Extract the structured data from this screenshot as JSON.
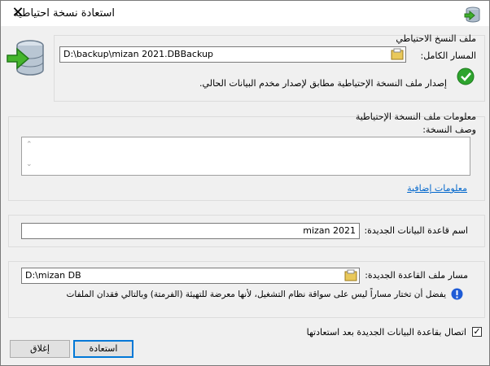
{
  "window": {
    "title": "استعادة نسخة احتياطية",
    "close_glyph": "✕"
  },
  "backup_file": {
    "group_label": "ملف النسخ الاحتياطي",
    "path_label": "المسار الكامل:",
    "path_value": "D:\\backup\\mizan 2021.DBBackup",
    "status_text": "إصدار ملف النسخة الإحتياطية مطابق لإصدار مخدم البيانات الحالي."
  },
  "backup_info": {
    "group_label": "معلومات ملف النسخة الإحتياطية",
    "description_label": "وصف النسخة:",
    "description_value": "",
    "more_info_link": "معلومات إضافية"
  },
  "new_db": {
    "name_label": "اسم قاعدة البيانات الجديدة:",
    "name_value": "mizan 2021"
  },
  "new_path": {
    "label": "مسار ملف القاعدة الجديدة:",
    "value": "D:\\mizan DB",
    "warning": "يفضل أن تختار مساراً ليس على سواقة نظام التشغيل، لأنها معرضة للتهيئة (الفرمتة) وبالتالي فقدان الملفات"
  },
  "connect_option": {
    "label": "اتصال بقاعدة البيانات الجديدة بعد استعادتها",
    "checked": true,
    "check_glyph": "✓"
  },
  "buttons": {
    "restore": "استعادة",
    "close": "إغلاق"
  },
  "colors": {
    "accent": "#0078d7",
    "link": "#0066cc",
    "ok_green": "#2ea42e",
    "warn_blue": "#1e5bd6"
  }
}
